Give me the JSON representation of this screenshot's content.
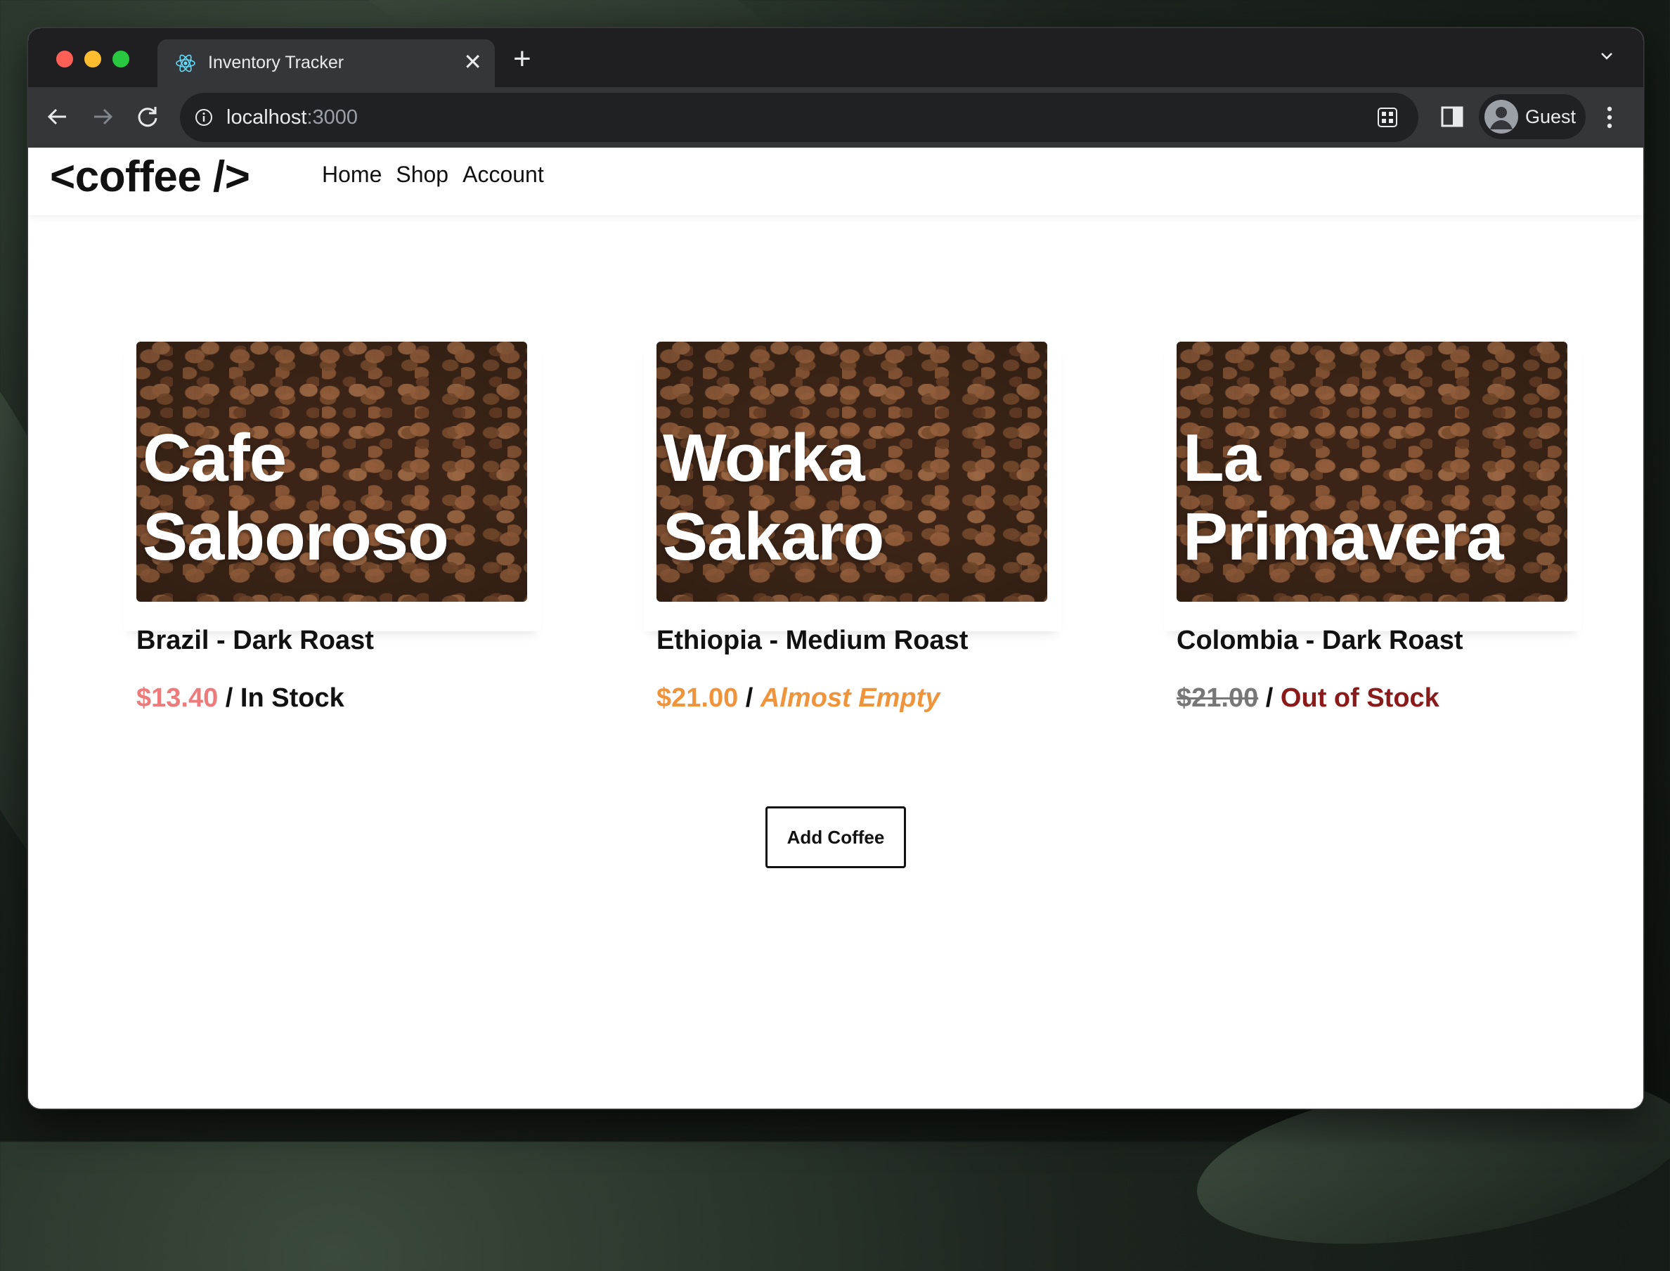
{
  "browser": {
    "tab_title": "Inventory Tracker",
    "url_host": "localhost",
    "url_port": ":3000",
    "profile_name": "Guest"
  },
  "site": {
    "logo": "<coffee />",
    "nav": [
      "Home",
      "Shop",
      "Account"
    ]
  },
  "coffees": [
    {
      "name": "Cafe Saboroso",
      "origin": "Brazil - Dark Roast",
      "price": "$13.40",
      "separator": " / ",
      "status": "In Stock",
      "status_color": "#111111",
      "price_color": "#ee7b7b"
    },
    {
      "name": "Worka Sakaro",
      "origin": "Ethiopia - Medium Roast",
      "price": "$21.00",
      "separator": " / ",
      "status": "Almost Empty",
      "status_color": "#f0943c",
      "price_color": "#f0943c"
    },
    {
      "name": "La Primavera",
      "origin": "Colombia - Dark Roast",
      "price": "$21.00",
      "separator": " / ",
      "status": "Out of Stock",
      "status_color": "#8b1a1a",
      "price_color": "#777777"
    }
  ],
  "actions": {
    "add_coffee": "Add Coffee"
  },
  "icons": {
    "favicon": "react-icon",
    "back": "arrow-left-icon",
    "forward": "arrow-right-icon",
    "reload": "reload-icon",
    "site_info": "info-icon",
    "extensions": "apps-icon",
    "side_panel": "side-panel-icon",
    "menu": "kebab-menu-icon"
  }
}
